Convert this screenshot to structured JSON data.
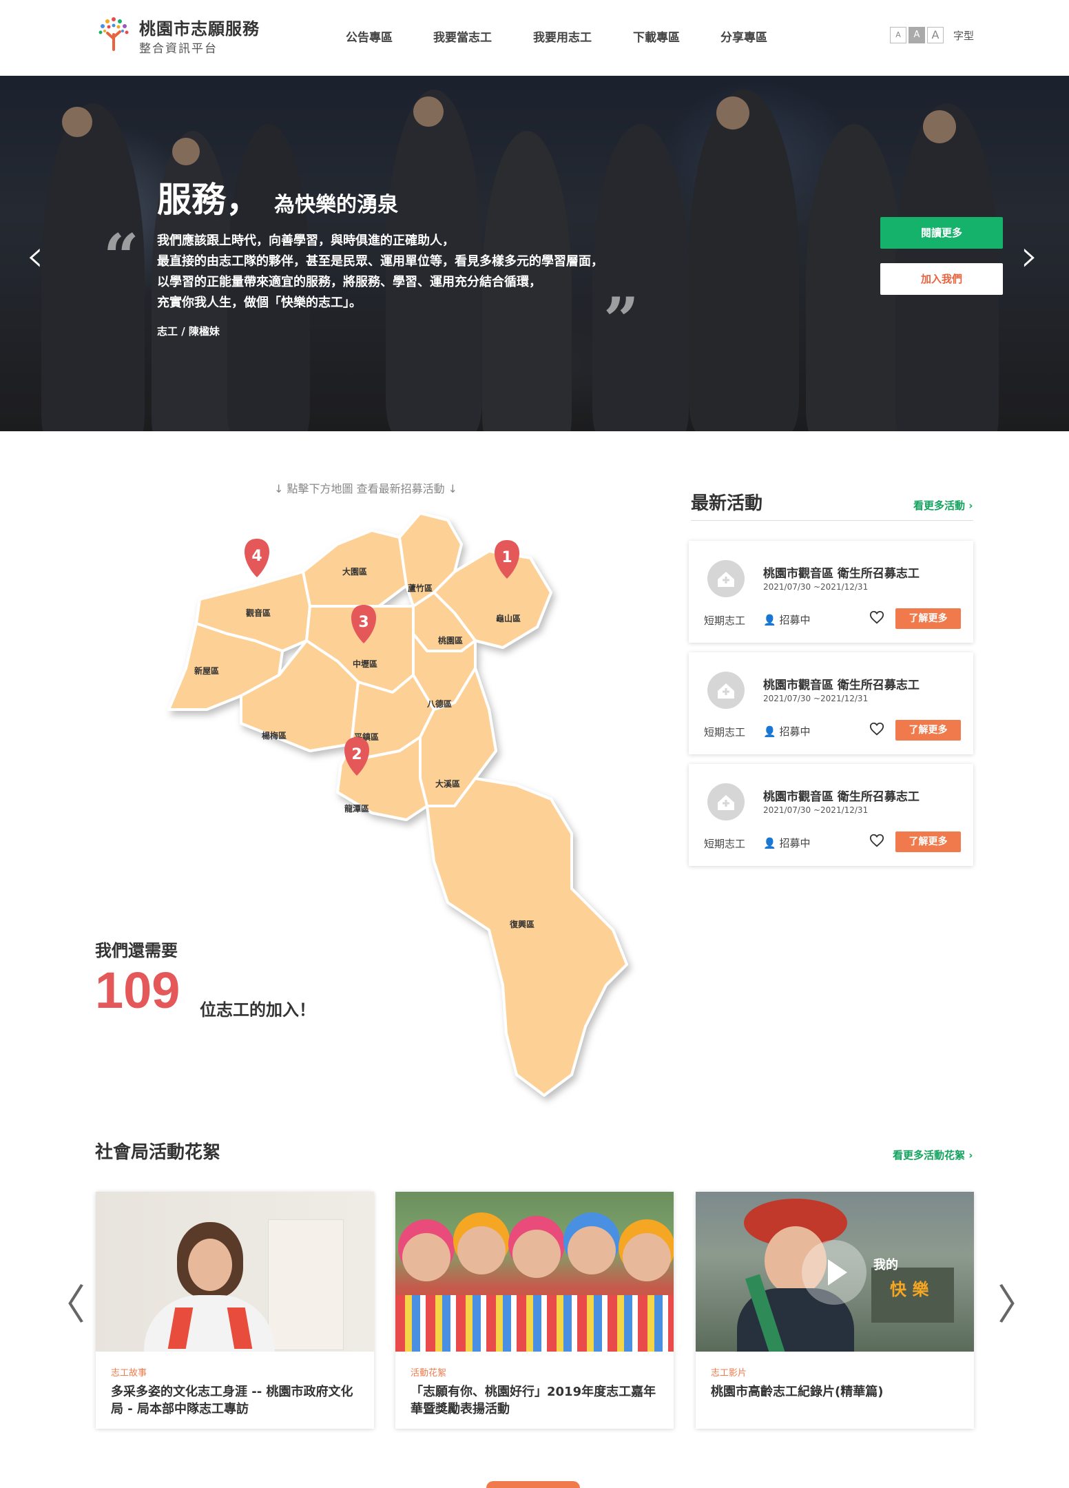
{
  "header": {
    "title": "桃園市志願服務",
    "subtitle": "整合資訊平台",
    "nav": [
      "公告專區",
      "我要當志工",
      "我要用志工",
      "下載專區",
      "分享專區"
    ],
    "font_sizes": [
      "A",
      "A",
      "A"
    ],
    "font_label": "字型"
  },
  "hero": {
    "title_main": "服務，",
    "title_sub": "為快樂的湧泉",
    "lines": [
      "我們應該跟上時代，向善學習，與時俱進的正確助人，",
      "最直接的由志工隊的夥伴，甚至是民眾、運用單位等，看見多樣多元的學習層面，",
      "以學習的正能量帶來適宜的服務，將服務、學習、運用充分結合循環，",
      "充實你我人生，做個「快樂的志工」。"
    ],
    "author": "志工 / 陳楹妹",
    "read_more": "閱讀更多",
    "join": "加入我們",
    "prev": "‹",
    "next": "›"
  },
  "map": {
    "hint": "↓ 點擊下方地圖 查看最新招募活動 ↓",
    "districts": [
      "大園區",
      "蘆竹區",
      "觀音區",
      "龜山區",
      "桃園區",
      "中壢區",
      "新屋區",
      "八德區",
      "楊梅區",
      "平鎮區",
      "大溪區",
      "龍潭區",
      "復興區"
    ],
    "pins": [
      "1",
      "2",
      "3",
      "4"
    ]
  },
  "need": {
    "label": "我們還需要",
    "count": "109",
    "suffix": "位志工的加入！"
  },
  "activities": {
    "title": "最新活動",
    "more": "看更多活動 ›",
    "items": [
      {
        "name": "桃園市觀音區 衛生所召募志工",
        "date": "2021/07/30 ~2021/12/31",
        "type": "短期志工",
        "status": "招募中",
        "button": "了解更多"
      },
      {
        "name": "桃園市觀音區 衛生所召募志工",
        "date": "2021/07/30 ~2021/12/31",
        "type": "短期志工",
        "status": "招募中",
        "button": "了解更多"
      },
      {
        "name": "桃園市觀音區 衛生所召募志工",
        "date": "2021/07/30 ~2021/12/31",
        "type": "短期志工",
        "status": "招募中",
        "button": "了解更多"
      }
    ]
  },
  "gallery": {
    "title": "社會局活動花絮",
    "more": "看更多活動花絮 ›",
    "prev": "〈",
    "next": "〉",
    "video_caption_1": "我的",
    "video_caption_2": "快 樂",
    "items": [
      {
        "category": "志工故事",
        "text": "多采多姿的文化志工身涯 -- 桃園市政府文化局 - 局本部中隊志工專訪"
      },
      {
        "category": "活動花絮",
        "text": "「志願有你、桃園好行」2019年度志工嘉年華暨獎勵表揚活動"
      },
      {
        "category": "志工影片",
        "text": "桃園市高齡志工紀錄片(精華篇)"
      }
    ]
  },
  "colors": {
    "accent_green": "#14b26b",
    "accent_orange": "#f07a4b",
    "pin_red": "#e4585a",
    "map_fill": "#fdd095"
  }
}
